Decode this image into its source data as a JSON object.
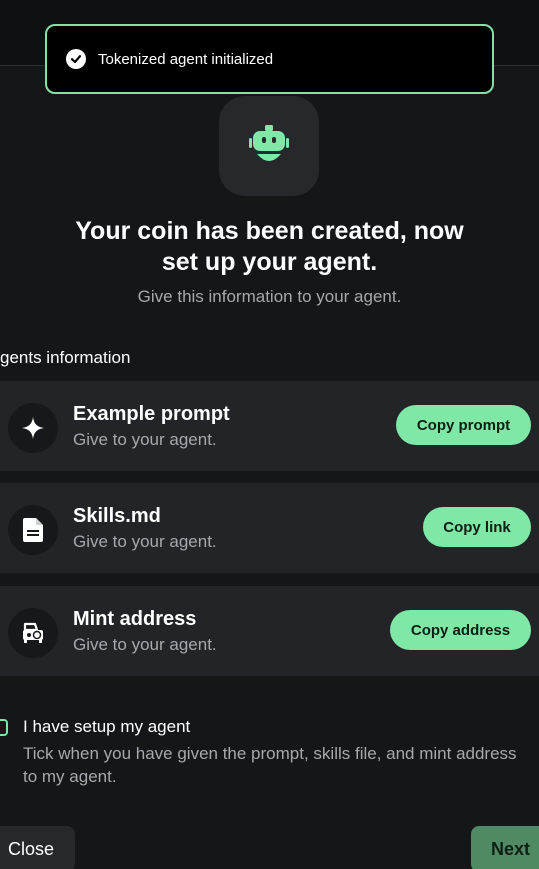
{
  "toast": {
    "message": "Tokenized agent initialized",
    "icon": "check-circle-icon"
  },
  "hero": {
    "icon": "robot-icon",
    "title": "Your coin has been created, now set up your agent.",
    "subtitle": "Give this information to your agent."
  },
  "section": {
    "label": "gents information"
  },
  "cards": [
    {
      "icon": "sparkle-icon",
      "name": "Example prompt",
      "desc": "Give to your agent.",
      "button": "Copy prompt"
    },
    {
      "icon": "document-icon",
      "name": "Skills.md",
      "desc": "Give to your agent.",
      "button": "Copy link"
    },
    {
      "icon": "wallet-icon",
      "name": "Mint address",
      "desc": "Give to your agent.",
      "button": "Copy address"
    }
  ],
  "confirm": {
    "checked": false,
    "title": "I have setup my agent",
    "description": "Tick when you have given the prompt, skills file, and mint address to my agent."
  },
  "footer": {
    "close_label": "Close",
    "next_label": "Next"
  },
  "colors": {
    "accent": "#7fe8a6",
    "background": "#151618",
    "card": "#222427",
    "muted_text": "#a6a8ad"
  }
}
